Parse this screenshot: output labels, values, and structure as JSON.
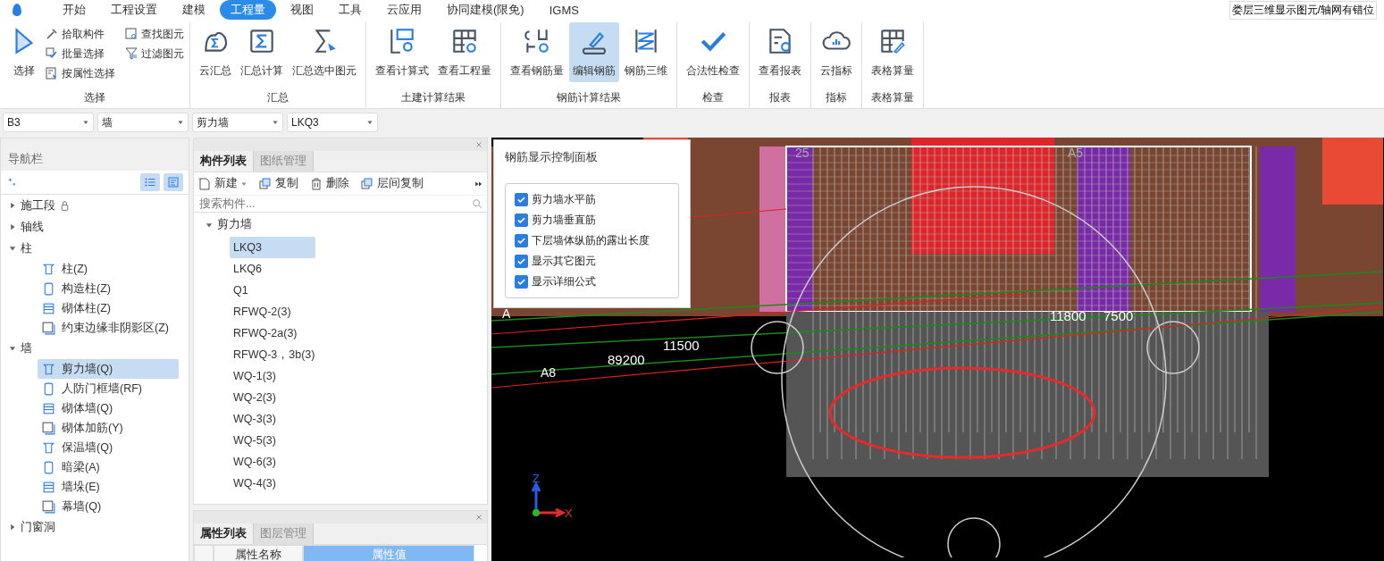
{
  "menu_tabs": [
    {
      "label": "开始",
      "selected": false
    },
    {
      "label": "工程设置",
      "selected": false
    },
    {
      "label": "建模",
      "selected": false
    },
    {
      "label": "工程量",
      "selected": true
    },
    {
      "label": "视图",
      "selected": false
    },
    {
      "label": "工具",
      "selected": false
    },
    {
      "label": "云应用",
      "selected": false
    },
    {
      "label": "协同建模(限免)",
      "selected": false
    },
    {
      "label": "IGMS",
      "selected": false
    }
  ],
  "status_hint": "娄层三维显示图元/轴网有错位",
  "ribbon_groups": [
    {
      "title": "选择",
      "tools": [
        {
          "label": "选择",
          "kind": "large",
          "selected": false
        },
        {
          "label": "拾取构件",
          "kind": "small",
          "selected": false
        },
        {
          "label": "批量选择",
          "kind": "small",
          "selected": false
        },
        {
          "label": "按属性选择",
          "kind": "small",
          "selected": false
        },
        {
          "label": "查找图元",
          "kind": "small",
          "selected": false
        },
        {
          "label": "过滤图元",
          "kind": "small",
          "selected": false
        }
      ]
    },
    {
      "title": "汇总",
      "tools": [
        {
          "label": "云汇总",
          "kind": "large",
          "selected": false
        },
        {
          "label": "汇总计算",
          "kind": "large",
          "selected": false
        },
        {
          "label": "汇总选中图元",
          "kind": "large",
          "selected": false
        }
      ]
    },
    {
      "title": "土建计算结果",
      "tools": [
        {
          "label": "查看计算式",
          "kind": "large",
          "selected": false
        },
        {
          "label": "查看工程量",
          "kind": "large",
          "selected": false
        }
      ]
    },
    {
      "title": "钢筋计算结果",
      "tools": [
        {
          "label": "查看钢筋量",
          "kind": "large",
          "selected": false
        },
        {
          "label": "编辑钢筋",
          "kind": "large",
          "selected": true
        },
        {
          "label": "钢筋三维",
          "kind": "large",
          "selected": false
        }
      ]
    },
    {
      "title": "检查",
      "tools": [
        {
          "label": "合法性检查",
          "kind": "large",
          "selected": false
        }
      ]
    },
    {
      "title": "报表",
      "tools": [
        {
          "label": "查看报表",
          "kind": "large",
          "selected": false
        }
      ]
    },
    {
      "title": "指标",
      "tools": [
        {
          "label": "云指标",
          "kind": "large",
          "selected": false
        }
      ]
    },
    {
      "title": "表格算量",
      "tools": [
        {
          "label": "表格算量",
          "kind": "large",
          "selected": false
        }
      ]
    }
  ],
  "selectors": [
    "B3",
    "墙",
    "剪力墙",
    "LKQ3"
  ],
  "nav": {
    "title": "导航栏",
    "items": [
      {
        "label": "施工段",
        "expanded": false,
        "locked": true
      },
      {
        "label": "轴线",
        "expanded": false,
        "locked": false
      },
      {
        "label": "柱",
        "expanded": true,
        "locked": false,
        "children": [
          {
            "label": "柱(Z)",
            "selected": false
          },
          {
            "label": "构造柱(Z)",
            "selected": false
          },
          {
            "label": "砌体柱(Z)",
            "selected": false
          },
          {
            "label": "约束边缘非阴影区(Z)",
            "selected": false
          }
        ]
      },
      {
        "label": "墙",
        "expanded": true,
        "locked": false,
        "children": [
          {
            "label": "剪力墙(Q)",
            "selected": true
          },
          {
            "label": "人防门框墙(RF)",
            "selected": false
          },
          {
            "label": "砌体墙(Q)",
            "selected": false
          },
          {
            "label": "砌体加筋(Y)",
            "selected": false
          },
          {
            "label": "保温墙(Q)",
            "selected": false
          },
          {
            "label": "暗梁(A)",
            "selected": false
          },
          {
            "label": "墙垛(E)",
            "selected": false
          },
          {
            "label": "幕墙(Q)",
            "selected": false
          }
        ]
      },
      {
        "label": "门窗洞",
        "expanded": false,
        "locked": false
      }
    ]
  },
  "component_panel": {
    "tabs": [
      {
        "label": "构件列表",
        "selected": true
      },
      {
        "label": "图纸管理",
        "selected": false
      }
    ],
    "toolbar": [
      "新建",
      "复制",
      "删除",
      "层间复制"
    ],
    "search": {
      "placeholder": "搜索构件..."
    },
    "group": {
      "label": "剪力墙",
      "expanded": true,
      "children": [
        {
          "label": "LKQ3",
          "selected": true
        },
        {
          "label": "LKQ6",
          "selected": false
        },
        {
          "label": "Q1",
          "selected": false
        },
        {
          "label": "RFWQ-2(3)",
          "selected": false
        },
        {
          "label": "RFWQ-2a(3)",
          "selected": false
        },
        {
          "label": "RFWQ-3，3b(3)",
          "selected": false
        },
        {
          "label": "WQ-1(3)",
          "selected": false
        },
        {
          "label": "WQ-2(3)",
          "selected": false
        },
        {
          "label": "WQ-3(3)",
          "selected": false
        },
        {
          "label": "WQ-5(3)",
          "selected": false
        },
        {
          "label": "WQ-6(3)",
          "selected": false
        },
        {
          "label": "WQ-4(3)",
          "selected": false
        }
      ]
    }
  },
  "property_panel": {
    "tabs": [
      {
        "label": "属性列表",
        "selected": true
      },
      {
        "label": "图层管理",
        "selected": false
      }
    ],
    "columns": [
      "属性名称",
      "属性值"
    ]
  },
  "rebar_panel": {
    "title": "钢筋显示控制面板",
    "options": [
      {
        "label": "剪力墙水平筋",
        "checked": true
      },
      {
        "label": "剪力墙垂直筋",
        "checked": true
      },
      {
        "label": "下层墙体纵筋的露出长度",
        "checked": true
      },
      {
        "label": "显示其它图元",
        "checked": true
      },
      {
        "label": "显示详细公式",
        "checked": true
      }
    ]
  },
  "viewport": {
    "labels": [
      "25",
      "A5",
      "A",
      "A8",
      "89200",
      "11500",
      "11800",
      "7500"
    ],
    "axis": [
      "Z",
      "X"
    ]
  }
}
